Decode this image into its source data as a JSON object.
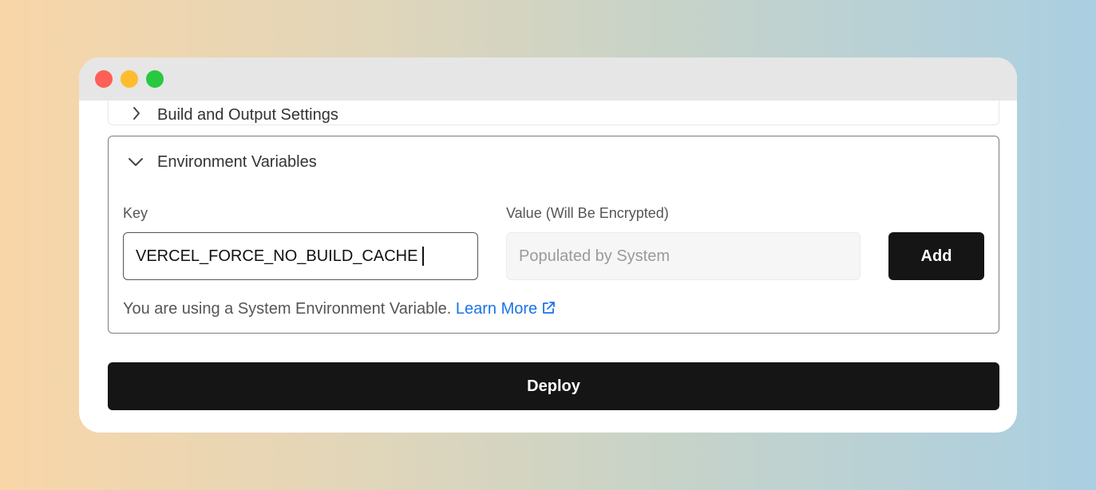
{
  "window": {
    "controls": [
      "close",
      "minimize",
      "maximize"
    ]
  },
  "build_panel": {
    "title": "Build and Output Settings",
    "icon": "chevron-right-icon",
    "expanded": false
  },
  "env_panel": {
    "title": "Environment Variables",
    "icon": "chevron-down-icon",
    "expanded": true,
    "key_label": "Key",
    "key_value": "VERCEL_FORCE_NO_BUILD_CACHE",
    "value_label": "Value (Will Be Encrypted)",
    "value_placeholder": "Populated by System",
    "add_label": "Add",
    "hint_text": "You are using a System Environment Variable.",
    "learn_more_label": "Learn More",
    "learn_more_icon": "external-link-icon"
  },
  "deploy": {
    "label": "Deploy"
  },
  "colors": {
    "button_bg": "#151515",
    "link": "#1a73e8",
    "close": "#fe5f57",
    "minimize": "#febc2e",
    "maximize": "#28c840"
  }
}
